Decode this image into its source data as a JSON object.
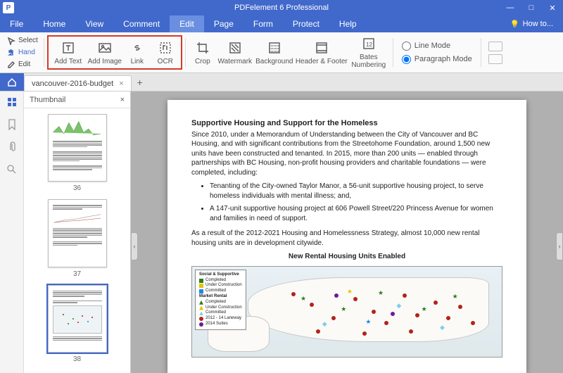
{
  "app_title": "PDFelement 6 Professional",
  "window_controls": {
    "min": "—",
    "max": "□",
    "close": "✕"
  },
  "menubar": {
    "items": [
      "File",
      "Home",
      "View",
      "Comment",
      "Edit",
      "Page",
      "Form",
      "Protect",
      "Help"
    ],
    "active_index": 4,
    "howto": "How to..."
  },
  "ribbon": {
    "quick": [
      {
        "label": "Select",
        "icon": "select-icon"
      },
      {
        "label": "Hand",
        "icon": "hand-icon"
      },
      {
        "label": "Edit",
        "icon": "edit-icon"
      }
    ],
    "highlighted": [
      {
        "label": "Add Text",
        "icon": "text-icon"
      },
      {
        "label": "Add Image",
        "icon": "image-icon"
      },
      {
        "label": "Link",
        "icon": "link-icon"
      },
      {
        "label": "OCR",
        "icon": "ocr-icon"
      }
    ],
    "other": [
      {
        "label": "Crop",
        "icon": "crop-icon"
      },
      {
        "label": "Watermark",
        "icon": "watermark-icon"
      },
      {
        "label": "Background",
        "icon": "background-icon"
      },
      {
        "label": "Header & Footer",
        "icon": "headerfooter-icon"
      },
      {
        "label": "Bates\nNumbering",
        "icon": "bates-icon"
      }
    ],
    "modes": {
      "line": "Line Mode",
      "paragraph": "Paragraph Mode",
      "selected": "paragraph"
    }
  },
  "tab": {
    "name": "vancouver-2016-budget"
  },
  "thumb_panel": {
    "title": "Thumbnail",
    "pages": [
      36,
      37,
      38
    ],
    "selected": 38
  },
  "document": {
    "heading": "Supportive Housing and Support for the Homeless",
    "para1": "Since 2010, under a Memorandum of Understanding between the City of Vancouver and BC Housing, and with significant contributions from the Streetohome Foundation, around 1,500 new units have been constructed and tenanted. In 2015, more than 200 units — enabled through partnerships with BC Housing, non-profit housing providers and charitable foundations — were completed, including:",
    "bullets": [
      "Tenanting of the City-owned Taylor Manor, a 56-unit supportive housing project, to serve homeless individuals with mental illness; and,",
      "A 147-unit supportive housing project at 606 Powell Street/220 Princess Avenue for women and families in need of support."
    ],
    "para2": "As a result of the 2012-2021 Housing and Homelessness Strategy, almost 10,000 new rental housing units are in development citywide.",
    "chart_title": "New Rental Housing Units Enabled",
    "legend": {
      "group1_title": "Social & Supportive",
      "group2_title": "Market Rental",
      "items": [
        {
          "label": "Completed",
          "color": "#2e7d1f"
        },
        {
          "label": "Under Construction",
          "color": "#e6c200"
        },
        {
          "label": "Committed",
          "color": "#1e88e5"
        },
        {
          "label": "Completed",
          "color": "#2e7d1f"
        },
        {
          "label": "Under Construction",
          "color": "#e6c200"
        },
        {
          "label": "Committed",
          "color": "#7fd0e8"
        },
        {
          "label": "2012 - 14 Laneway",
          "color": "#b2231a"
        },
        {
          "label": "2014 Suites",
          "color": "#6a1b9a"
        }
      ]
    }
  }
}
